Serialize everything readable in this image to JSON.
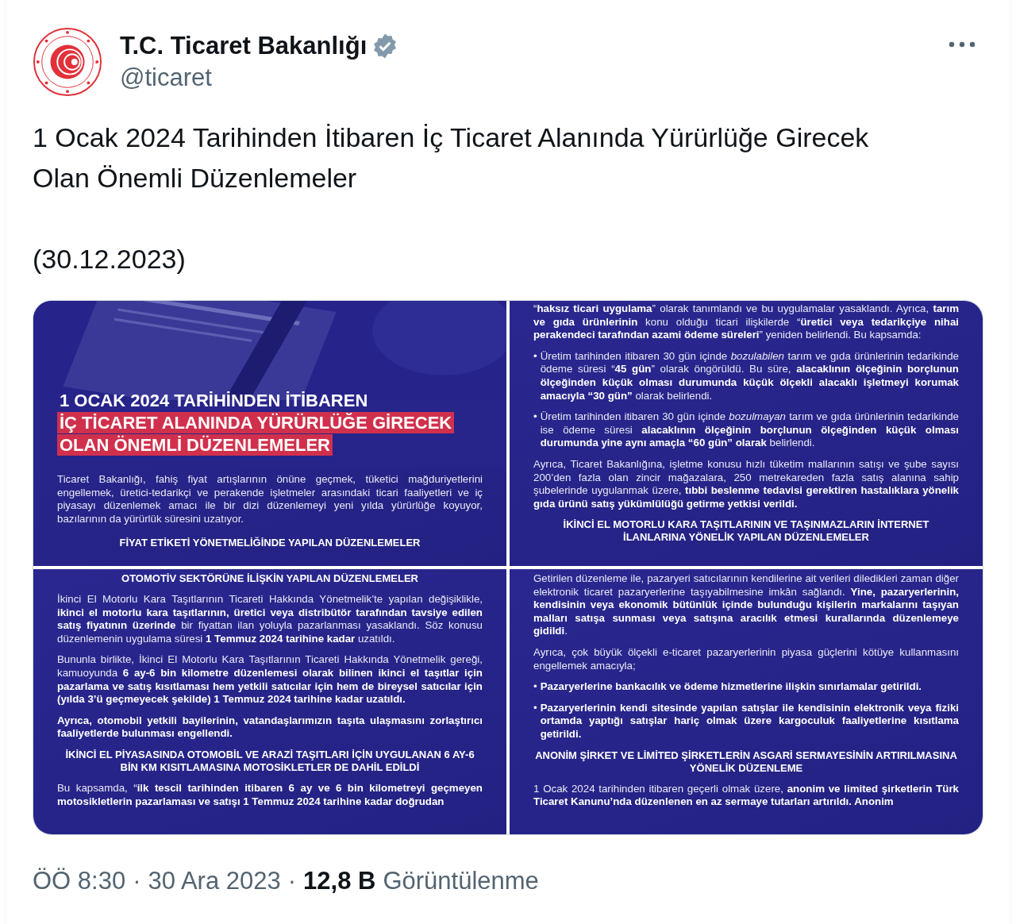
{
  "account": {
    "name": "T.C. Ticaret Bakanlığı",
    "handle": "@ticaret"
  },
  "tweet_text": [
    "1 Ocak 2024 Tarihinden İtibaren İç Ticaret Alanında Yürürlüğe Girecek Olan Önemli Düzenlemeler",
    "(30.12.2023)"
  ],
  "image_rows": [
    [
      {
        "kind": "cover",
        "blocks": [
          {
            "kind": "title",
            "lines": [
              {
                "text": "1 OCAK 2024 TARİHİNDEN İTİBAREN",
                "highlighted": false
              },
              {
                "text": "İÇ TİCARET ALANINDA YÜRÜRLÜĞE GİRECEK",
                "highlighted": true
              },
              {
                "text": "OLAN ÖNEMLİ DÜZENLEMELER",
                "highlighted": true
              }
            ]
          },
          {
            "kind": "paragraph",
            "text": "Ticaret Bakanlığı, fahiş fiyat artışlarının önüne geçmek, tüketici mağduriyetlerini engellemek, üretici-tedarikçi ve perakende işletmeler arasındaki ticari faaliyetleri ve iç piyasayı düzenlemek amacı ile bir dizi düzenlemeyi yeni yılda yürürlüğe koyuyor, bazılarının da yürürlük süresini uzatıyor."
          },
          {
            "kind": "heading",
            "text": "FİYAT ETİKETİ YÖNETMELİĞİNDE YAPILAN DÜZENLEMELER"
          }
        ]
      },
      {
        "kind": "text",
        "blocks": [
          {
            "kind": "paragraph",
            "text": "“**haksız ticari uygulama**” olarak tanımlandı ve bu uygulamalar yasaklandı. Ayrıca, **tarım ve gıda ürünlerinin** konu olduğu ticari ilişkilerde “**üretici veya tedarikçiye nihai perakendeci tarafından azami ödeme süreleri**” yeniden belirlendi. Bu kapsamda:"
          },
          {
            "kind": "bullet",
            "marker": "•",
            "text": "Üretim tarihinden itibaren 30 gün içinde *bozulabilen* tarım ve gıda ürünlerinin tedarikinde ödeme süresi “**45 gün**” olarak öngörüldü. Bu süre, **alacaklının ölçeğinin borçlunun ölçeğinden küçük olması durumunda küçük ölçekli alacaklı işletmeyi korumak amacıyla “30 gün”** olarak belirlendi."
          },
          {
            "kind": "bullet",
            "marker": "•",
            "text": "Üretim tarihinden itibaren 30 gün içinde *bozulmayan* tarım ve gıda ürünlerinin tedarikinde ise ödeme süresi **alacaklının ölçeğinin borçlunun ölçeğinden küçük olması durumunda yine aynı amaçla “60 gün” olarak** belirlendi."
          },
          {
            "kind": "paragraph",
            "text": "Ayrıca, Ticaret Bakanlığına, işletme konusu hızlı tüketim mallarının satışı ve şube sayısı 200’den fazla olan zincir mağazalara, 250 metrekareden fazla satış alanına sahip şubelerinde uygulanmak üzere, **tıbbi beslenme tedavisi gerektiren hastalıklara yönelik gıda ürünü satış yükümlülüğü getirme yetkisi verildi.**"
          },
          {
            "kind": "heading",
            "text": "İKİNCİ EL MOTORLU KARA TAŞITLARININ VE TAŞINMAZLARIN İNTERNET İLANLARINA YÖNELİK YAPILAN DÜZENLEMELER"
          }
        ]
      }
    ],
    [
      {
        "kind": "text",
        "blocks": [
          {
            "kind": "heading",
            "text": "OTOMOTİV SEKTÖRÜNE İLİŞKİN YAPILAN DÜZENLEMELER"
          },
          {
            "kind": "paragraph",
            "text": "İkinci El Motorlu Kara Taşıtlarının Ticareti Hakkında Yönetmelik’te yapılan değişiklikle, **ikinci el motorlu kara taşıtlarının, üretici veya distribütör tarafından tavsiye edilen satış fiyatının üzerinde** bir fiyattan ilan yoluyla pazarlanması yasaklandı. Söz konusu düzenlemenin uygulama süresi **1 Temmuz 2024 tarihine kadar** uzatıldı."
          },
          {
            "kind": "paragraph",
            "text": "Bununla birlikte, İkinci El Motorlu Kara Taşıtlarının Ticareti Hakkında Yönetmelik gereği, kamuoyunda **6 ay-6 bin kilometre düzenlemesi olarak bilinen ikinci el taşıtlar için pazarlama ve satış kısıtlaması hem yetkili satıcılar için hem de bireysel satıcılar için (yılda 3’ü geçmeyecek şekilde) 1 Temmuz 2024 tarihine kadar uzatıldı.**"
          },
          {
            "kind": "paragraph",
            "text": "**Ayrıca, otomobil yetkili bayilerinin, vatandaşlarımızın taşıta ulaşmasını zorlaştırıcı faaliyetlerde bulunması engellendi.**"
          },
          {
            "kind": "heading",
            "text": "İKİNCİ EL PİYASASINDA OTOMOBİL VE ARAZİ TAŞITLARI İÇİN UYGULANAN 6 AY-6 BİN KM KISITLAMASINA MOTOSİKLETLER DE DAHİL EDİLDİ"
          },
          {
            "kind": "paragraph",
            "text": "Bu kapsamda, “**ilk tescil tarihinden itibaren 6 ay ve 6 bin kilometreyi geçmeyen motosikletlerin pazarlaması ve satışı 1 Temmuz 2024 tarihine kadar doğrudan**"
          }
        ]
      },
      {
        "kind": "text",
        "blocks": [
          {
            "kind": "paragraph",
            "text": "Getirilen düzenleme ile, pazaryeri satıcılarının kendilerine ait verileri diledikleri zaman diğer elektronik ticaret pazaryerlerine taşıyabilmesine imkân sağlandı. **Yine, pazaryerlerinin, kendisinin veya ekonomik bütünlük içinde bulunduğu kişilerin markalarını taşıyan malları satışa sunması veya satışına aracılık etmesi kurallarında düzenlemeye gidildi**."
          },
          {
            "kind": "paragraph",
            "text": "Ayrıca, çok büyük ölçekli e-ticaret pazaryerlerinin piyasa güçlerini kötüye kullanmasını engellemek amacıyla;"
          },
          {
            "kind": "bullet",
            "marker": "•",
            "text": "**Pazaryerlerine bankacılık ve ödeme hizmetlerine ilişkin sınırlamalar getirildi.**"
          },
          {
            "kind": "bullet",
            "marker": "•",
            "text": "**Pazaryerlerinin kendi sitesinde yapılan satışlar ile kendisinin elektronik veya fiziki ortamda yaptığı satışlar hariç olmak üzere kargoculuk faaliyetlerine kısıtlama getirildi.**"
          },
          {
            "kind": "heading",
            "text": "ANONİM ŞİRKET VE LİMİTED ŞİRKETLERİN ASGARİ SERMAYESİNİN ARTIRILMASINA YÖNELİK DÜZENLEME"
          },
          {
            "kind": "paragraph",
            "text": "1 Ocak 2024 tarihinden itibaren geçerli olmak üzere, **anonim ve limited şirketlerin Türk Ticaret Kanunu’nda düzenlenen en az sermaye tutarları artırıldı. Anonim**"
          }
        ]
      }
    ]
  ],
  "meta": [
    {
      "kind": "time",
      "text": "ÖÖ 8:30"
    },
    {
      "kind": "separator",
      "text": "·"
    },
    {
      "kind": "date",
      "text": "30 Ara 2023"
    },
    {
      "kind": "separator",
      "text": "·"
    },
    {
      "kind": "count",
      "text": "12,8 B"
    },
    {
      "kind": "label",
      "text": "Görüntülenme"
    }
  ]
}
